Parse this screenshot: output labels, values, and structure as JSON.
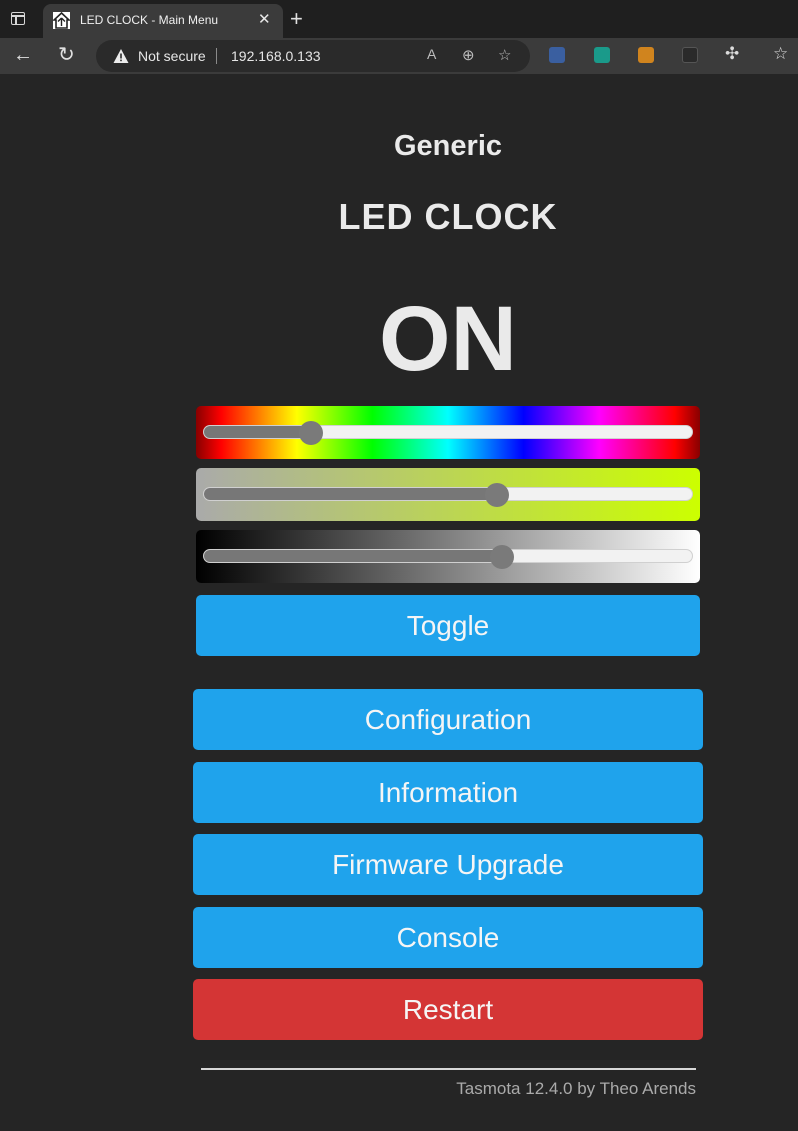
{
  "browser": {
    "tab_title": "LED CLOCK - Main Menu",
    "new_tab_label": "+",
    "security_text": "Not secure",
    "url": "192.168.0.133"
  },
  "device": {
    "module_name": "Generic",
    "friendly_name": "LED CLOCK",
    "power_state": "ON"
  },
  "sliders": {
    "hue_percent": 22,
    "saturation_percent": 60,
    "brightness_percent": 61
  },
  "buttons": {
    "toggle": "Toggle",
    "configuration": "Configuration",
    "information": "Information",
    "firmware_upgrade": "Firmware Upgrade",
    "console": "Console",
    "restart": "Restart"
  },
  "footer": {
    "version_text": "Tasmota 12.4.0 by Theo Arends"
  },
  "colors": {
    "button_blue": "#1fa3ec",
    "button_red": "#d43535",
    "page_background": "#252525"
  }
}
